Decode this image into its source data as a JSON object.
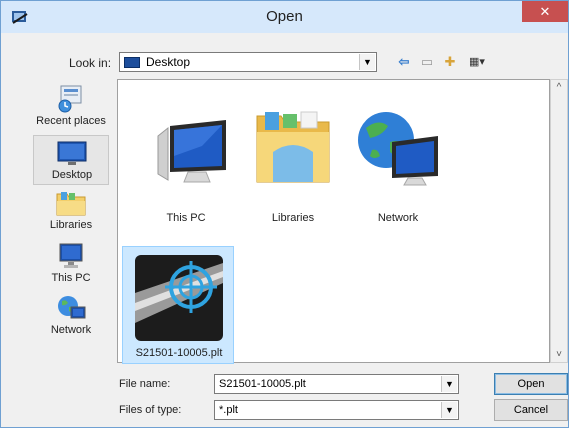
{
  "window": {
    "title": "Open",
    "close_label": "✕"
  },
  "toolbar": {
    "look_in_label": "Look in:",
    "look_in_value": "Desktop",
    "back_glyph": "⇦",
    "up_glyph": "▭",
    "newfolder_glyph": "✚",
    "views_glyph": "▦▾"
  },
  "places": [
    {
      "label": "Recent places",
      "icon": "recent-places-icon"
    },
    {
      "label": "Desktop",
      "icon": "desktop-icon",
      "selected": true
    },
    {
      "label": "Libraries",
      "icon": "libraries-icon"
    },
    {
      "label": "This PC",
      "icon": "this-pc-icon"
    },
    {
      "label": "Network",
      "icon": "network-icon"
    }
  ],
  "files": [
    {
      "label": "This PC",
      "icon": "this-pc-icon"
    },
    {
      "label": "Libraries",
      "icon": "libraries-folder-icon"
    },
    {
      "label": "Network",
      "icon": "network-globe-icon"
    },
    {
      "label": "S21501-10005.plt",
      "icon": "plt-file-icon",
      "selected": true
    }
  ],
  "form": {
    "file_name_label": "File name:",
    "file_name_value": "S21501-10005.plt",
    "file_type_label": "Files of type:",
    "file_type_value": "*.plt",
    "open_label": "Open",
    "cancel_label": "Cancel"
  },
  "scroll": {
    "up_glyph": "^",
    "down_glyph": "˅"
  },
  "colors": {
    "accent": "#3c7fb1",
    "selection": "#cce8ff",
    "close": "#c75050",
    "titlebar": "#d6e8fb"
  }
}
